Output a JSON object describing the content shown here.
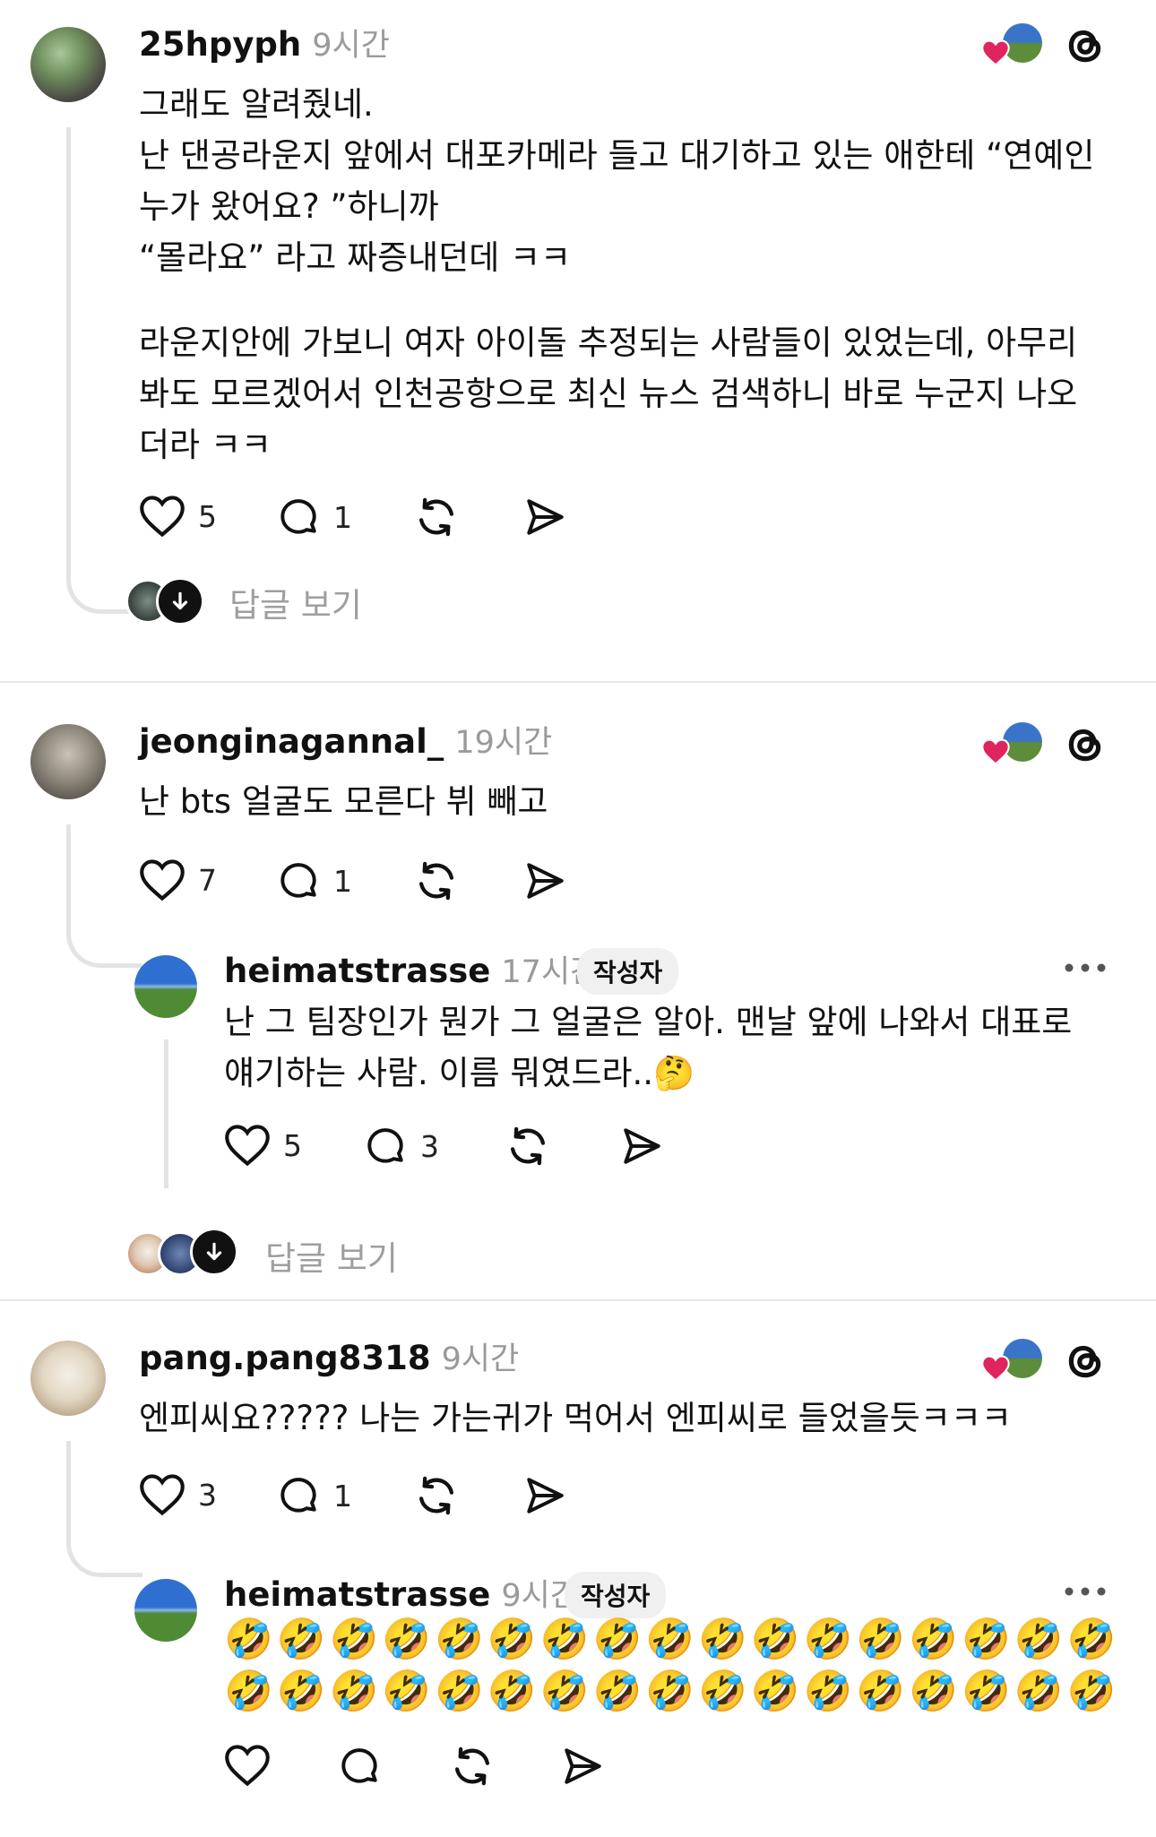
{
  "posts": [
    {
      "username": "25hpyph",
      "time": "9시간",
      "paragraphs": [
        "그래도 알려줬네.",
        "난 댄공라운지 앞에서 대포카메라 들고 대기하고 있는 애한테 “연예인 누가 왔어요? ”하니까",
        "“몰라요” 라고 짜증내던데 ㅋㅋ",
        "라운지안에 가보니 여자 아이돌 추정되는 사람들이 있었는데, 아무리 봐도 모르겠어서 인천공항으로 최신 뉴스 검색하니 바로 누군지 나오더라 ㅋㅋ"
      ],
      "likes": "5",
      "comments": "1",
      "view_replies": "답글 보기"
    },
    {
      "username": "jeonginagannal_",
      "time": "19시간",
      "text": "난 bts 얼굴도 모른다 뷔 빼고",
      "likes": "7",
      "comments": "1",
      "reply": {
        "username": "heimatstrasse",
        "time": "17시간",
        "badge": "작성자",
        "text": "난 그 팀장인가 뭔가 그 얼굴은 알아. 맨날 앞에 나와서 대표로 얘기하는 사람. 이름 뭐였드라..🤔",
        "likes": "5",
        "comments": "3"
      },
      "view_replies": "답글 보기"
    },
    {
      "username": "pang.pang8318",
      "time": "9시간",
      "text": "엔피씨요????? 나는 가는귀가 먹어서 엔피씨로 들었을듯ㅋㅋㅋ",
      "likes": "3",
      "comments": "1",
      "reply": {
        "username": "heimatstrasse",
        "time": "9시간",
        "badge": "작성자",
        "emoji_line1": "🤣🤣🤣🤣🤣🤣🤣🤣🤣🤣🤣🤣🤣🤣🤣🤣🤣",
        "emoji_line2": "🤣🤣🤣🤣🤣🤣🤣🤣🤣🤣🤣🤣🤣🤣🤣🤣🤣"
      }
    }
  ],
  "colors": {
    "text": "#111111",
    "muted": "#9a9a9a",
    "thread": "#e3e3e3",
    "heart_red": "#e0245e"
  },
  "icons": [
    "heart-icon",
    "comment-icon",
    "repost-icon",
    "share-icon",
    "threads-logo-icon",
    "more-icon",
    "arrow-down-icon"
  ]
}
